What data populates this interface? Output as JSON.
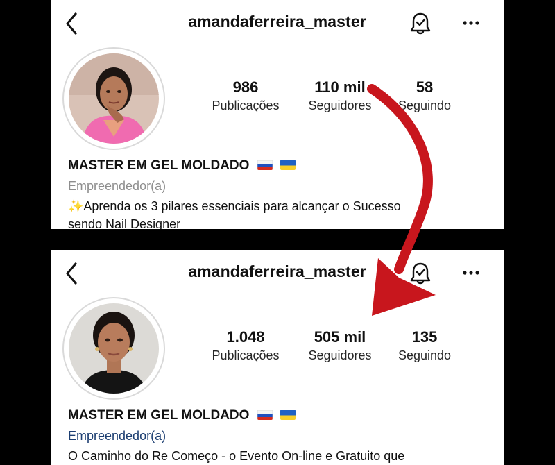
{
  "colors": {
    "arrow": "#c8161d",
    "category_before": "#8e8e8e",
    "category_after": "#1d3f72"
  },
  "before": {
    "handle": "amandaferreira_master",
    "stats": [
      {
        "value": "986",
        "label": "Publicações"
      },
      {
        "value": "110 mil",
        "label": "Seguidores"
      },
      {
        "value": "58",
        "label": "Seguindo"
      }
    ],
    "name": "MASTER EM GEL MOLDADO",
    "category": "Empreendedor(a)",
    "bio_line1": "✨Aprenda os 3 pilares essenciais para alcançar o Sucesso",
    "bio_line2": "sendo Nail Designer"
  },
  "after": {
    "handle": "amandaferreira_master",
    "stats": [
      {
        "value": "1.048",
        "label": "Publicações"
      },
      {
        "value": "505 mil",
        "label": "Seguidores"
      },
      {
        "value": "135",
        "label": "Seguindo"
      }
    ],
    "name": "MASTER EM GEL MOLDADO",
    "category": "Empreendedor(a)",
    "bio_line1": "O Caminho do Re Começo - o Evento On-line e Gratuito que"
  },
  "icons": [
    "back-arrow-icon",
    "bell-check-icon",
    "more-dots-icon",
    "russia-flag-icon",
    "ukraine-flag-icon",
    "red-curved-arrow-icon"
  ]
}
